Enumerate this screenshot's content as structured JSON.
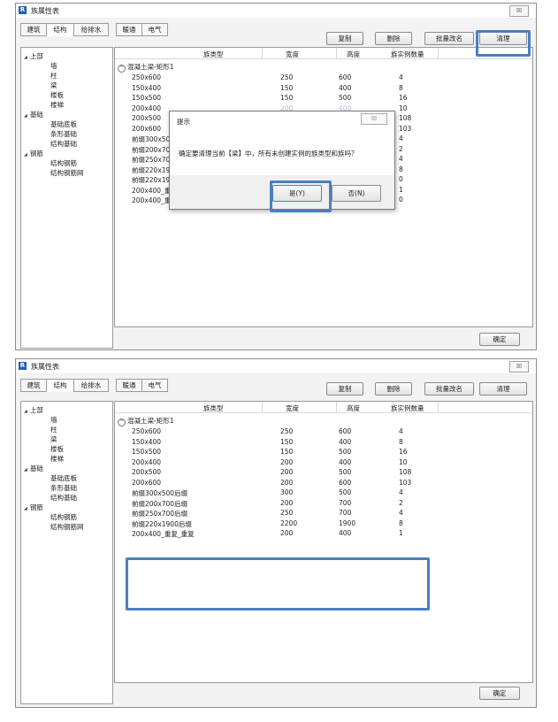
{
  "window_title": "族属性表",
  "app_icon": "R",
  "close_glyph": "☒",
  "tabs": [
    "建筑",
    "结构",
    "给排水",
    "暖通",
    "电气"
  ],
  "actions": {
    "copy": "复制",
    "delete": "删除",
    "batch_rename": "批量改名",
    "purge": "清理",
    "ok": "确定"
  },
  "tree": {
    "upper": "上部",
    "upper_items": [
      "墙",
      "柱",
      "梁",
      "楼板",
      "楼梯"
    ],
    "foundation": "基础",
    "foundation_items": [
      "基础底板",
      "条形基础",
      "结构基础"
    ],
    "rebar": "钢筋",
    "rebar_items": [
      "结构钢筋",
      "结构钢筋网"
    ]
  },
  "table": {
    "headers": [
      "族类型",
      "宽度",
      "高度",
      "族实例数量"
    ],
    "group": "混凝土梁-矩形1",
    "rows_before": [
      [
        "250x600",
        "250",
        "600",
        "4"
      ],
      [
        "150x400",
        "150",
        "400",
        "8"
      ],
      [
        "150x500",
        "150",
        "500",
        "16"
      ],
      [
        "200x400",
        "200",
        "400",
        "10"
      ],
      [
        "200x500",
        "200",
        "500",
        "108"
      ],
      [
        "200x600",
        "200",
        "600",
        "103"
      ],
      [
        "前缀300x500后缀",
        "300",
        "500",
        "4"
      ],
      [
        "前缀200x700后缀",
        "200",
        "700",
        "2"
      ],
      [
        "前缀250x700后缀",
        "250",
        "700",
        "4"
      ],
      [
        "前缀220x1900后缀",
        "2200",
        "1900",
        "8"
      ],
      [
        "前缀220x190后缀",
        "220",
        "190",
        "0"
      ],
      [
        "200x400_重复_重复",
        "200",
        "400",
        "1"
      ],
      [
        "200x400_重复",
        "300",
        "400",
        "0"
      ]
    ],
    "rows_after": [
      [
        "250x600",
        "250",
        "600",
        "4"
      ],
      [
        "150x400",
        "150",
        "400",
        "8"
      ],
      [
        "150x500",
        "150",
        "500",
        "16"
      ],
      [
        "200x400",
        "200",
        "400",
        "10"
      ],
      [
        "200x500",
        "200",
        "500",
        "108"
      ],
      [
        "200x600",
        "200",
        "600",
        "103"
      ],
      [
        "前缀300x500后缀",
        "300",
        "500",
        "4"
      ],
      [
        "前缀200x700后缀",
        "200",
        "700",
        "2"
      ],
      [
        "前缀250x700后缀",
        "250",
        "700",
        "4"
      ],
      [
        "前缀220x1900后缀",
        "2200",
        "1900",
        "8"
      ],
      [
        "200x400_重复_重复",
        "200",
        "400",
        "1"
      ]
    ]
  },
  "dialog": {
    "title": "提示",
    "message": "确定要清理当前【梁】中，所有未创建实例的族类型和族吗？",
    "yes": "是(Y)",
    "no": "否(N)"
  },
  "colors": {
    "highlight": "#4a7fc1",
    "accent_icon": "#1f5fb5"
  }
}
